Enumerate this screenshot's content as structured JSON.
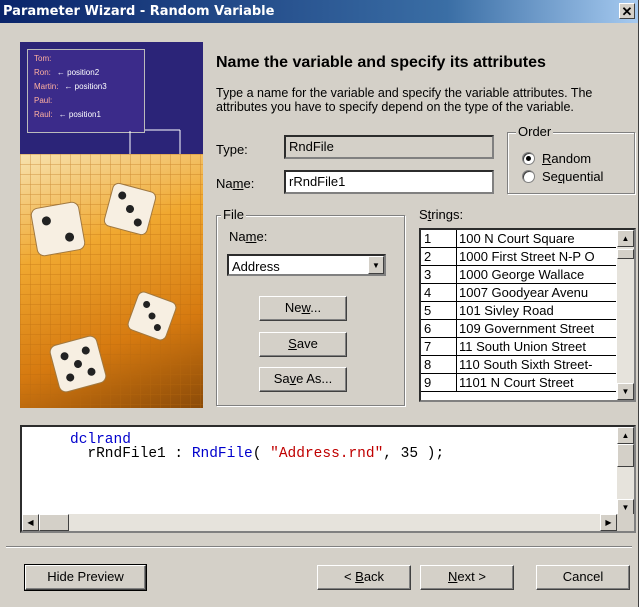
{
  "window": {
    "title": "Parameter Wizard - Random Variable",
    "close_glyph": "✕"
  },
  "illustration": {
    "names": [
      {
        "name": "Tom:",
        "position": ""
      },
      {
        "name": "Ron:",
        "position": "← position2"
      },
      {
        "name": "Martin:",
        "position": "← position3"
      },
      {
        "name": "Paul:",
        "position": ""
      },
      {
        "name": "Raul:",
        "position": "← position1"
      }
    ]
  },
  "heading": "Name the variable and specify its attributes",
  "description": "Type a name for the variable and specify the variable attributes. The attributes you have to specify depend on the type of the variable.",
  "type": {
    "label": "Type:",
    "value": "RndFile"
  },
  "name": {
    "label_pre": "Na",
    "label_ul": "m",
    "label_post": "e:",
    "value": "rRndFile1"
  },
  "order": {
    "title": "Order",
    "options": [
      {
        "pre": "",
        "ul": "R",
        "post": "andom",
        "selected": true
      },
      {
        "pre": "Se",
        "ul": "q",
        "post": "uential",
        "selected": false
      }
    ]
  },
  "file": {
    "title": "File",
    "name_label_pre": "Na",
    "name_label_ul": "m",
    "name_label_post": "e:",
    "selected": "Address",
    "new_pre": "Ne",
    "new_ul": "w",
    "new_post": "...",
    "save_pre": "",
    "save_ul": "S",
    "save_post": "ave",
    "saveas_pre": "Sa",
    "saveas_ul": "v",
    "saveas_post": "e As..."
  },
  "strings": {
    "label_pre": "S",
    "label_ul": "t",
    "label_post": "rings:",
    "rows": [
      {
        "n": "1",
        "v": "100 N Court Square"
      },
      {
        "n": "2",
        "v": "1000 First Street N-P O"
      },
      {
        "n": "3",
        "v": "1000 George Wallace"
      },
      {
        "n": "4",
        "v": "1007 Goodyear Avenu"
      },
      {
        "n": "5",
        "v": "101 Sivley Road"
      },
      {
        "n": "6",
        "v": "109 Government Street"
      },
      {
        "n": "7",
        "v": "11 South Union Street"
      },
      {
        "n": "8",
        "v": "110 South Sixth Street-"
      },
      {
        "n": "9",
        "v": "1101 N Court Street"
      }
    ]
  },
  "preview": {
    "line1_kw": "dclrand",
    "line2_pre": "rRndFile1 : ",
    "line2_kw": "RndFile",
    "line2_mid": "( ",
    "line2_str": "\"Address.rnd\"",
    "line2_post": ", 35 );"
  },
  "footer": {
    "hide_preview": "Hide Preview",
    "back_pre": "< ",
    "back_ul": "B",
    "back_post": "ack",
    "next_pre": "",
    "next_ul": "N",
    "next_post": "ext >",
    "cancel": "Cancel"
  }
}
